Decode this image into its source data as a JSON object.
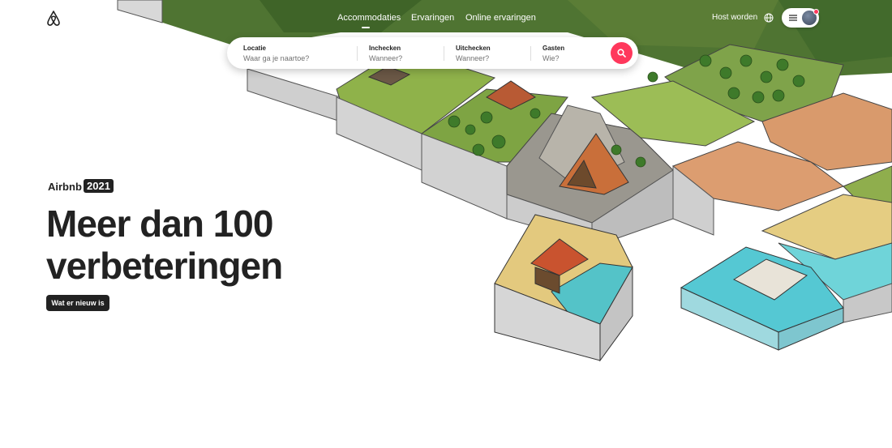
{
  "header": {
    "nav": [
      "Accommodaties",
      "Ervaringen",
      "Online ervaringen"
    ],
    "active_nav": "Accommodaties",
    "host_label": "Host worden"
  },
  "search": {
    "fields": [
      {
        "label": "Locatie",
        "placeholder": "Waar ga je naartoe?"
      },
      {
        "label": "Inchecken",
        "placeholder": "Wanneer?"
      },
      {
        "label": "Uitchecken",
        "placeholder": "Wanneer?"
      },
      {
        "label": "Gasten",
        "placeholder": "Wie?"
      }
    ]
  },
  "hero": {
    "brand": "Airbnb",
    "year": "2021",
    "headline": "Meer dan 100 verbeteringen",
    "cta": "Wat er nieuw is"
  },
  "icons": {
    "logo": "airbnb-logo",
    "globe": "globe-icon",
    "menu": "hamburger-icon",
    "search": "search-icon",
    "avatar": "user-avatar"
  },
  "colors": {
    "accent": "#ff385c",
    "dark": "#222222",
    "grass": "#6f9a3c",
    "desert": "#d89a6a",
    "sand": "#e6cf86",
    "water": "#5fd0d6"
  }
}
